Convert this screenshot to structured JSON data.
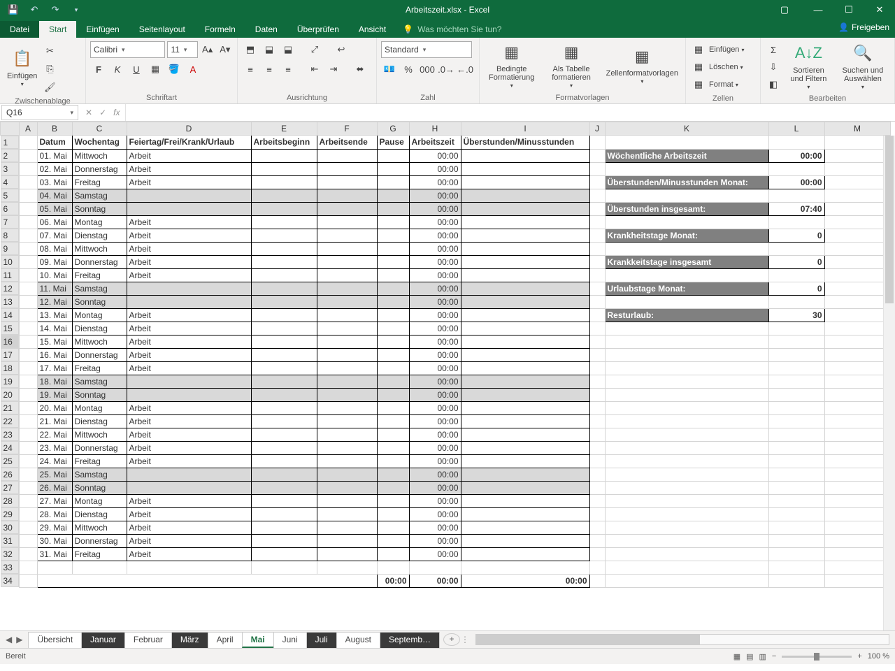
{
  "title": "Arbeitszeit.xlsx - Excel",
  "qat": {
    "save": "💾"
  },
  "menus": {
    "datei": "Datei",
    "start": "Start",
    "einfuegen": "Einfügen",
    "seitenlayout": "Seitenlayout",
    "formeln": "Formeln",
    "daten": "Daten",
    "ueberpruefen": "Überprüfen",
    "ansicht": "Ansicht",
    "tell": "Was möchten Sie tun?",
    "share": "Freigeben"
  },
  "ribbon": {
    "einfuegen": "Einfügen",
    "zwischenablage": "Zwischenablage",
    "font": "Calibri",
    "size": "11",
    "schriftart": "Schriftart",
    "ausrichtung": "Ausrichtung",
    "numfmt": "Standard",
    "zahl": "Zahl",
    "bedingte": "Bedingte Formatierung",
    "alstabelle": "Als Tabelle formatieren",
    "zellvorl": "Zellenformatvorlagen",
    "formatvorlagen": "Formatvorlagen",
    "ins": "Einfügen",
    "del": "Löschen",
    "fmt": "Format",
    "zellen": "Zellen",
    "sort": "Sortieren und Filtern",
    "find": "Suchen und Auswählen",
    "bearbeiten": "Bearbeiten"
  },
  "namebox": "Q16",
  "cols": [
    "A",
    "B",
    "C",
    "D",
    "E",
    "F",
    "G",
    "H",
    "I",
    "J",
    "K",
    "L",
    "M"
  ],
  "headers": {
    "b": "Datum",
    "c": "Wochentag",
    "d": "Feiertag/Frei/Krank/Urlaub",
    "e": "Arbeitsbeginn",
    "f": "Arbeitsende",
    "g": "Pause",
    "h": "Arbeitszeit",
    "i": "Überstunden/Minusstunden"
  },
  "rows": [
    {
      "n": 2,
      "b": "01. Mai",
      "c": "Mittwoch",
      "d": "Arbeit",
      "h": "00:00"
    },
    {
      "n": 3,
      "b": "02. Mai",
      "c": "Donnerstag",
      "d": "Arbeit",
      "h": "00:00"
    },
    {
      "n": 4,
      "b": "03. Mai",
      "c": "Freitag",
      "d": "Arbeit",
      "h": "00:00"
    },
    {
      "n": 5,
      "b": "04. Mai",
      "c": "Samstag",
      "d": "",
      "h": "00:00",
      "we": true
    },
    {
      "n": 6,
      "b": "05. Mai",
      "c": "Sonntag",
      "d": "",
      "h": "00:00",
      "we": true
    },
    {
      "n": 7,
      "b": "06. Mai",
      "c": "Montag",
      "d": "Arbeit",
      "h": "00:00"
    },
    {
      "n": 8,
      "b": "07. Mai",
      "c": "Dienstag",
      "d": "Arbeit",
      "h": "00:00"
    },
    {
      "n": 9,
      "b": "08. Mai",
      "c": "Mittwoch",
      "d": "Arbeit",
      "h": "00:00"
    },
    {
      "n": 10,
      "b": "09. Mai",
      "c": "Donnerstag",
      "d": "Arbeit",
      "h": "00:00"
    },
    {
      "n": 11,
      "b": "10. Mai",
      "c": "Freitag",
      "d": "Arbeit",
      "h": "00:00"
    },
    {
      "n": 12,
      "b": "11. Mai",
      "c": "Samstag",
      "d": "",
      "h": "00:00",
      "we": true
    },
    {
      "n": 13,
      "b": "12. Mai",
      "c": "Sonntag",
      "d": "",
      "h": "00:00",
      "we": true
    },
    {
      "n": 14,
      "b": "13. Mai",
      "c": "Montag",
      "d": "Arbeit",
      "h": "00:00"
    },
    {
      "n": 15,
      "b": "14. Mai",
      "c": "Dienstag",
      "d": "Arbeit",
      "h": "00:00"
    },
    {
      "n": 16,
      "b": "15. Mai",
      "c": "Mittwoch",
      "d": "Arbeit",
      "h": "00:00"
    },
    {
      "n": 17,
      "b": "16. Mai",
      "c": "Donnerstag",
      "d": "Arbeit",
      "h": "00:00"
    },
    {
      "n": 18,
      "b": "17. Mai",
      "c": "Freitag",
      "d": "Arbeit",
      "h": "00:00"
    },
    {
      "n": 19,
      "b": "18. Mai",
      "c": "Samstag",
      "d": "",
      "h": "00:00",
      "we": true
    },
    {
      "n": 20,
      "b": "19. Mai",
      "c": "Sonntag",
      "d": "",
      "h": "00:00",
      "we": true
    },
    {
      "n": 21,
      "b": "20. Mai",
      "c": "Montag",
      "d": "Arbeit",
      "h": "00:00"
    },
    {
      "n": 22,
      "b": "21. Mai",
      "c": "Dienstag",
      "d": "Arbeit",
      "h": "00:00"
    },
    {
      "n": 23,
      "b": "22. Mai",
      "c": "Mittwoch",
      "d": "Arbeit",
      "h": "00:00"
    },
    {
      "n": 24,
      "b": "23. Mai",
      "c": "Donnerstag",
      "d": "Arbeit",
      "h": "00:00"
    },
    {
      "n": 25,
      "b": "24. Mai",
      "c": "Freitag",
      "d": "Arbeit",
      "h": "00:00"
    },
    {
      "n": 26,
      "b": "25. Mai",
      "c": "Samstag",
      "d": "",
      "h": "00:00",
      "we": true
    },
    {
      "n": 27,
      "b": "26. Mai",
      "c": "Sonntag",
      "d": "",
      "h": "00:00",
      "we": true
    },
    {
      "n": 28,
      "b": "27. Mai",
      "c": "Montag",
      "d": "Arbeit",
      "h": "00:00"
    },
    {
      "n": 29,
      "b": "28. Mai",
      "c": "Dienstag",
      "d": "Arbeit",
      "h": "00:00"
    },
    {
      "n": 30,
      "b": "29. Mai",
      "c": "Mittwoch",
      "d": "Arbeit",
      "h": "00:00"
    },
    {
      "n": 31,
      "b": "30. Mai",
      "c": "Donnerstag",
      "d": "Arbeit",
      "h": "00:00"
    },
    {
      "n": 32,
      "b": "31. Mai",
      "c": "Freitag",
      "d": "Arbeit",
      "h": "00:00"
    }
  ],
  "totals": {
    "g": "00:00",
    "h": "00:00",
    "i": "00:00"
  },
  "summary": [
    {
      "row": 2,
      "label": "Wöchentliche Arbeitszeit",
      "val": "00:00"
    },
    {
      "row": 4,
      "label": "Überstunden/Minusstunden Monat:",
      "val": "00:00"
    },
    {
      "row": 6,
      "label": "Überstunden insgesamt:",
      "val": "07:40"
    },
    {
      "row": 8,
      "label": "Krankheitstage Monat:",
      "val": "0"
    },
    {
      "row": 10,
      "label": "Krankkeitstage insgesamt",
      "val": "0"
    },
    {
      "row": 12,
      "label": "Urlaubstage Monat:",
      "val": "0"
    },
    {
      "row": 14,
      "label": "Resturlaub:",
      "val": "30"
    }
  ],
  "sheets": [
    {
      "name": "Übersicht",
      "dark": false
    },
    {
      "name": "Januar",
      "dark": true
    },
    {
      "name": "Februar",
      "dark": false
    },
    {
      "name": "März",
      "dark": true
    },
    {
      "name": "April",
      "dark": false
    },
    {
      "name": "Mai",
      "active": true
    },
    {
      "name": "Juni",
      "dark": false
    },
    {
      "name": "Juli",
      "dark": true
    },
    {
      "name": "August",
      "dark": false
    },
    {
      "name": "Septemb…",
      "dark": true
    }
  ],
  "status": {
    "ready": "Bereit",
    "zoom": "100 %"
  },
  "colwidths": {
    "A": 26,
    "B": 50,
    "C": 78,
    "D": 178,
    "E": 94,
    "F": 86,
    "G": 46,
    "H": 74,
    "I": 184,
    "J": 22,
    "K": 234,
    "L": 80,
    "M": 94
  }
}
